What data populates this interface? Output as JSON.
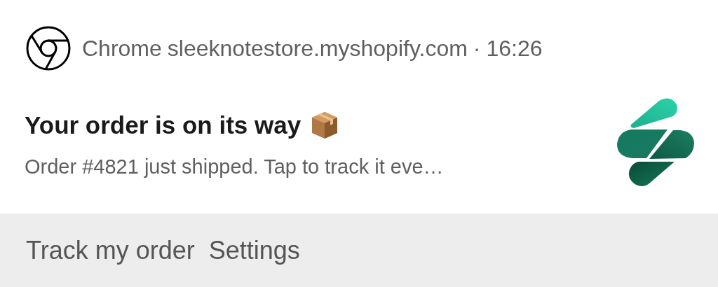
{
  "header": {
    "app": "Chrome",
    "site": "sleeknotestore.myshopify.com",
    "separator": "·",
    "time": "16:26"
  },
  "notification": {
    "title": "Your order is on its way",
    "body": "Order #4821 just shipped. Tap to track it eve…"
  },
  "actions": [
    "Track my order",
    "Settings"
  ]
}
